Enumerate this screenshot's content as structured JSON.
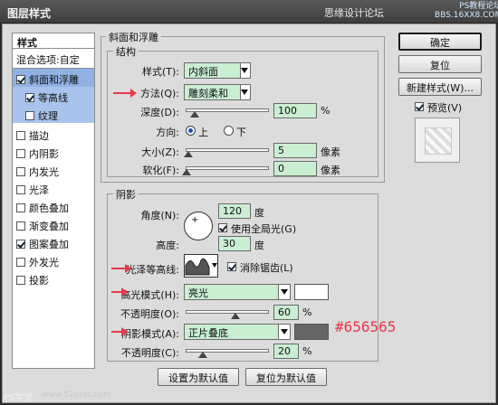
{
  "window": {
    "title": "图层样式",
    "watermark": "思缘设计论坛",
    "watermark_site_1": "PS教程论坛",
    "watermark_site_2": "BBS.16XX8.COM"
  },
  "sidebar": {
    "header": "样式",
    "blend_options": "混合选项:自定",
    "items": [
      {
        "label": "斜面和浮雕",
        "checked": true
      },
      {
        "label": "等高线",
        "checked": true
      },
      {
        "label": "纹理",
        "checked": false
      },
      {
        "label": "描边",
        "checked": false
      },
      {
        "label": "内阴影",
        "checked": false
      },
      {
        "label": "内发光",
        "checked": false
      },
      {
        "label": "光泽",
        "checked": false
      },
      {
        "label": "颜色叠加",
        "checked": false
      },
      {
        "label": "渐变叠加",
        "checked": false
      },
      {
        "label": "图案叠加",
        "checked": true
      },
      {
        "label": "外发光",
        "checked": false
      },
      {
        "label": "投影",
        "checked": false
      }
    ]
  },
  "bevel": {
    "panel_title": "斜面和浮雕",
    "structure_title": "结构",
    "style_label": "样式(T):",
    "style_value": "内斜面",
    "technique_label": "方法(Q):",
    "technique_value": "雕刻柔和",
    "depth_label": "深度(D):",
    "depth_value": "100",
    "depth_unit": "%",
    "depth_fraction": 0.1,
    "direction_label": "方向:",
    "direction_up": "上",
    "direction_down": "下",
    "size_label": "大小(Z):",
    "size_value": "5",
    "size_unit": "像素",
    "size_fraction": 0.02,
    "soften_label": "软化(F):",
    "soften_value": "0",
    "soften_unit": "像素",
    "soften_fraction": 0.0
  },
  "shading": {
    "title": "阴影",
    "angle_label": "角度(N):",
    "angle_value": "120",
    "angle_unit": "度",
    "global_light_label": "使用全局光(G)",
    "global_light_checked": true,
    "altitude_label": "高度:",
    "altitude_value": "30",
    "altitude_unit": "度",
    "gloss_label": "光泽等高线:",
    "antialias_label": "消除锯齿(L)",
    "antialias_checked": true,
    "highlight_mode_label": "高光模式(H):",
    "highlight_mode_value": "亮光",
    "highlight_color": "#ffffff",
    "highlight_opacity_label": "不透明度(O):",
    "highlight_opacity_value": "60",
    "highlight_opacity_unit": "%",
    "highlight_opacity_fraction": 0.6,
    "shadow_mode_label": "阴影模式(A):",
    "shadow_mode_value": "正片叠底",
    "shadow_color": "#656565",
    "shadow_color_note": "#656565",
    "shadow_opacity_label": "不透明度(C):",
    "shadow_opacity_value": "20",
    "shadow_opacity_unit": "%",
    "shadow_opacity_fraction": 0.2
  },
  "bottom": {
    "set_default": "设置为默认值",
    "reset_default": "复位为默认值"
  },
  "actions": {
    "ok": "确定",
    "reset": "复位",
    "new_style": "新建样式(W)...",
    "preview_label": "预览(V)",
    "preview_checked": true
  },
  "footer": {
    "logo_text": "PS学堂",
    "url": "www.52psxt.com"
  },
  "colors": {
    "field_bg": "#c9eed2",
    "arrow": "#e8384b",
    "selection": "#8fb1e4"
  }
}
